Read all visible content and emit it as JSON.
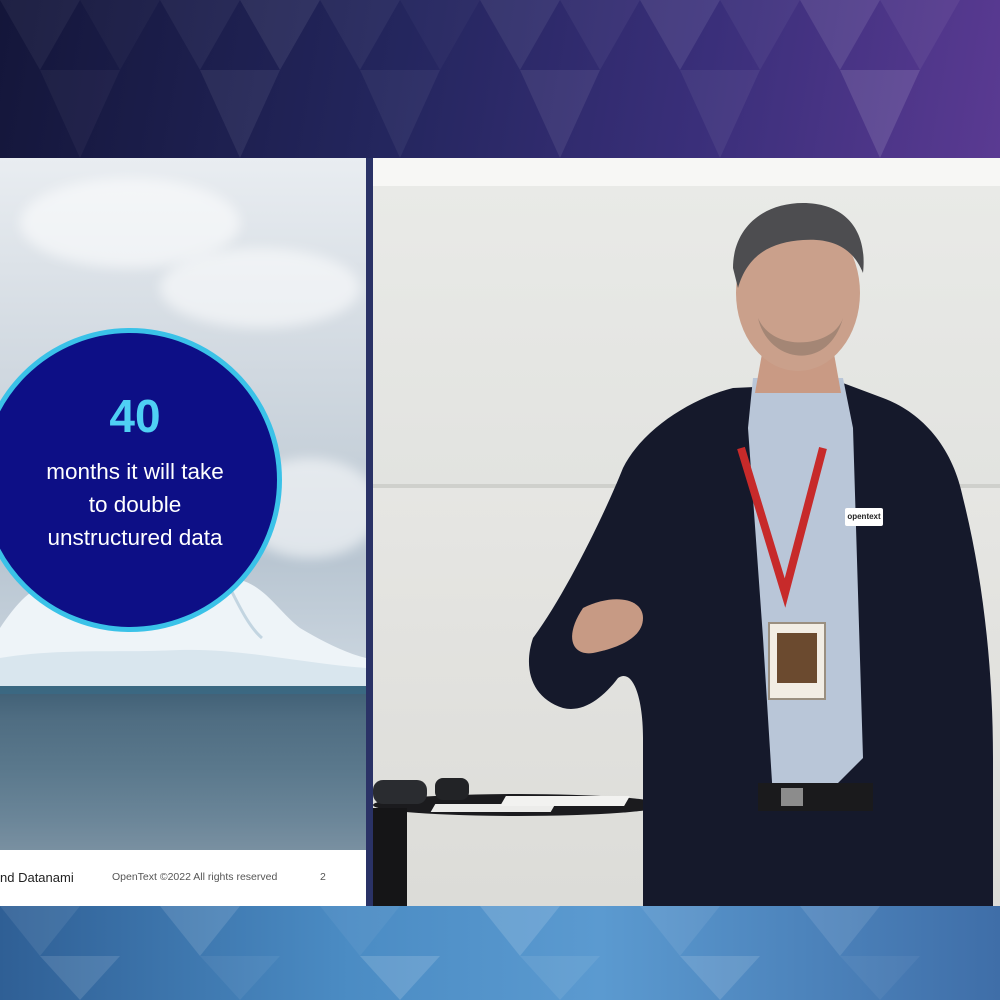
{
  "slide": {
    "stat_number": "40",
    "stat_text": "months it will take to double unstructured data",
    "footer_source": "nd Datanami",
    "footer_copyright": "OpenText ©2022 All rights reserved",
    "footer_page": "2"
  },
  "camera": {
    "badge_text": "opentext"
  },
  "colors": {
    "circle_fill": "#0d0f86",
    "circle_ring": "#3ac2e8",
    "stat_number": "#4fd0f4"
  }
}
